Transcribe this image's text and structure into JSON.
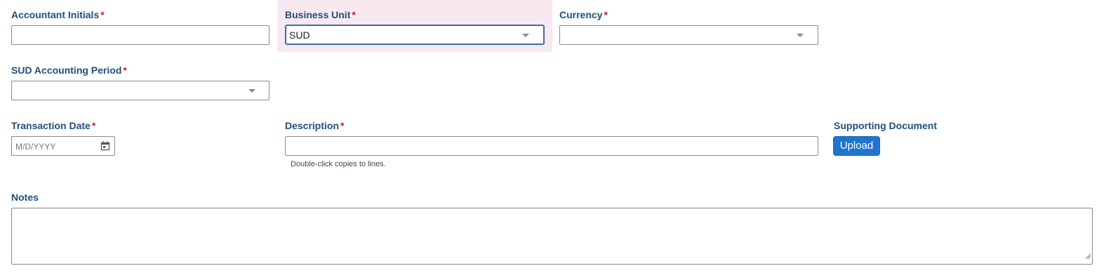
{
  "form": {
    "accountant_initials": {
      "label": "Accountant Initials",
      "required_mark": "*",
      "value": ""
    },
    "business_unit": {
      "label": "Business Unit",
      "required_mark": "*",
      "value": "SUD"
    },
    "currency": {
      "label": "Currency",
      "required_mark": "*",
      "value": ""
    },
    "accounting_period": {
      "label": "SUD Accounting Period",
      "required_mark": "*",
      "value": ""
    },
    "transaction_date": {
      "label": "Transaction Date",
      "required_mark": "*",
      "placeholder": "M/D/YYYY"
    },
    "description": {
      "label": "Description",
      "required_mark": "*",
      "value": "",
      "hint": "Double-click copies to lines."
    },
    "supporting_document": {
      "label": "Supporting Document",
      "upload_label": "Upload"
    },
    "notes": {
      "label": "Notes",
      "value": ""
    }
  },
  "colors": {
    "label": "#1f4f7a",
    "required": "#c0262d",
    "highlight_bg": "#f8e9f1",
    "primary_button": "#1f74cf"
  },
  "icons": [
    "dropdown-caret-icon",
    "calendar-icon",
    "resize-grip-icon"
  ]
}
